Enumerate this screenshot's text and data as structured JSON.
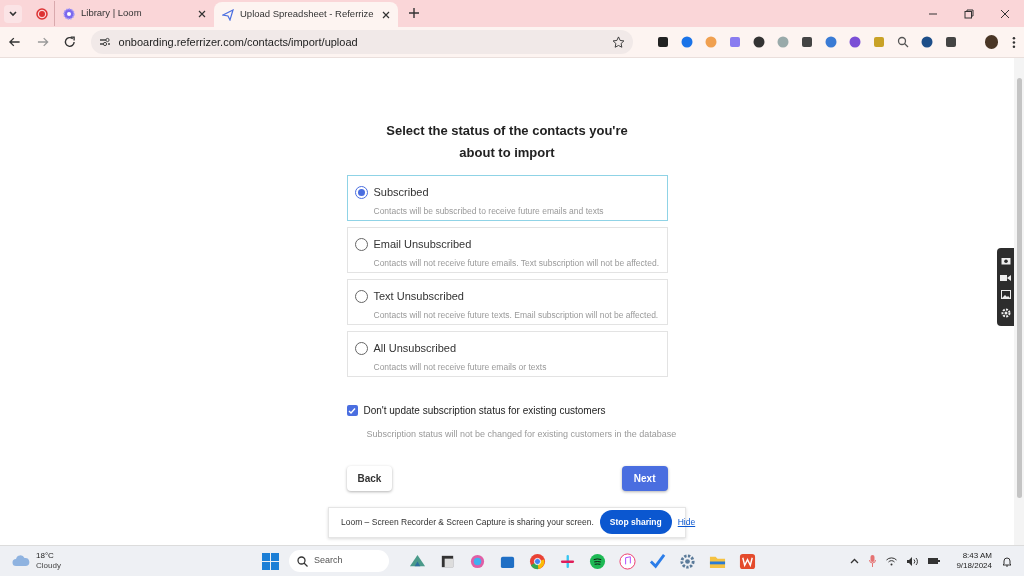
{
  "browser": {
    "tabs": [
      {
        "label": "Library | Loom",
        "selected": false,
        "kind": "loom"
      },
      {
        "label": "Upload Spreadsheet - Referrize",
        "selected": true,
        "kind": "send"
      }
    ],
    "url": "onboarding.referrizer.com/contacts/import/upload"
  },
  "page": {
    "heading": "Select the status of the contacts you're about to import",
    "options": [
      {
        "label": "Subscribed",
        "description": "Contacts will be subscribed to receive future emails and texts",
        "selected": true
      },
      {
        "label": "Email Unsubscribed",
        "description": "Contacts will not receive future emails. Text subscription will not be affected.",
        "selected": false
      },
      {
        "label": "Text Unsubscribed",
        "description": "Contacts will not receive future texts. Email subscription will not be affected.",
        "selected": false
      },
      {
        "label": "All Unsubscribed",
        "description": "Contacts will not receive future emails or texts",
        "selected": false
      }
    ],
    "keep_status": {
      "label": "Don't update subscription status for existing customers",
      "checked": true,
      "hint": "Subscription status will not be changed for existing customers in the database"
    },
    "back_button": "Back",
    "next_button": "Next"
  },
  "loom_bar": {
    "message": "Loom – Screen Recorder & Screen Capture is sharing your screen.",
    "stop_button": "Stop sharing",
    "hide_link": "Hide"
  },
  "taskbar": {
    "weather": {
      "temperature": "18°C",
      "condition": "Cloudy"
    },
    "search_placeholder": "Search",
    "time": "8:43 AM",
    "date": "9/18/2024"
  }
}
